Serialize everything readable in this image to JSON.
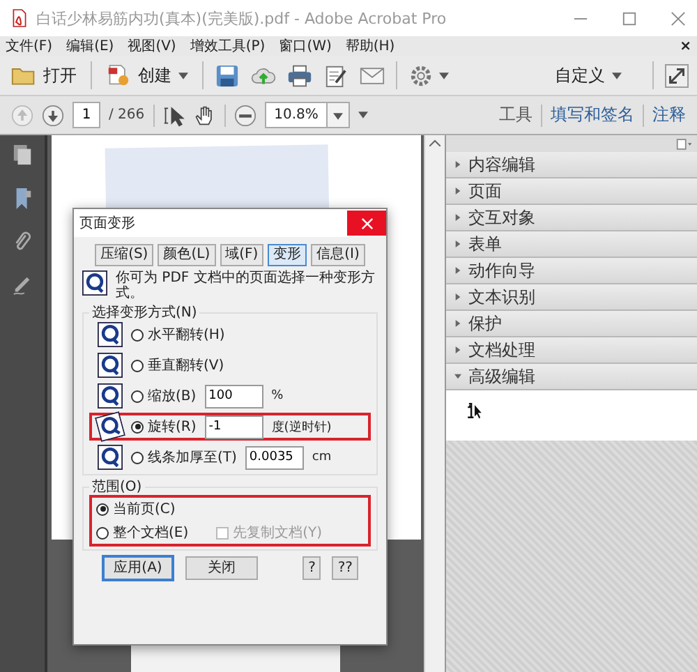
{
  "window": {
    "title": "白话少林易筋内功(真本)(完美版).pdf - Adobe Acrobat Pro"
  },
  "menu": [
    "文件(F)",
    "编辑(E)",
    "视图(V)",
    "增效工具(P)",
    "窗口(W)",
    "帮助(H)"
  ],
  "menu_close": "×",
  "toolbar": {
    "open": "打开",
    "create": "创建",
    "customize": "自定义"
  },
  "nav": {
    "page": "1",
    "page_count": "/ 266",
    "zoom": "10.8%"
  },
  "panel_tabs": [
    {
      "label": "工具",
      "color": "#555555"
    },
    {
      "label": "填写和签名",
      "color": "#2d5f9a"
    },
    {
      "label": "注释",
      "color": "#2d5f9a"
    }
  ],
  "panel_items": [
    {
      "label": "内容编辑",
      "expanded": false
    },
    {
      "label": "页面",
      "expanded": false
    },
    {
      "label": "交互对象",
      "expanded": false
    },
    {
      "label": "表单",
      "expanded": false
    },
    {
      "label": "动作向导",
      "expanded": false
    },
    {
      "label": "文本识别",
      "expanded": false
    },
    {
      "label": "保护",
      "expanded": false
    },
    {
      "label": "文档处理",
      "expanded": false
    },
    {
      "label": "高级编辑",
      "expanded": true
    }
  ],
  "dialog": {
    "title": "页面变形",
    "tabs": [
      {
        "label": "压缩(S)",
        "selected": false
      },
      {
        "label": "颜色(L)",
        "selected": false
      },
      {
        "label": "域(F)",
        "selected": false
      },
      {
        "label": "变形",
        "selected": true
      },
      {
        "label": "信息(I)",
        "selected": false
      }
    ],
    "description": "你可为 PDF 文档中的页面选择一种变形方式。",
    "method_group": "选择变形方式(N)",
    "options": [
      {
        "label": "水平翻转(H)",
        "selected": false,
        "highlighted": false
      },
      {
        "label": "垂直翻转(V)",
        "selected": false,
        "highlighted": false
      },
      {
        "label": "缩放(B)",
        "selected": false,
        "highlighted": false,
        "value": "100",
        "unit": "%"
      },
      {
        "label": "旋转(R)",
        "selected": true,
        "highlighted": true,
        "value": "-1",
        "unit": "度(逆时针)"
      },
      {
        "label": "线条加厚至(T)",
        "selected": false,
        "highlighted": false,
        "value": "0.0035",
        "unit": "cm"
      }
    ],
    "range": {
      "label": "范围(O)",
      "highlighted": true,
      "options": [
        {
          "label": "当前页(C)",
          "selected": true
        },
        {
          "label": "整个文档(E)",
          "selected": false
        }
      ],
      "copy_first": {
        "label": "先复制文档(Y)",
        "checked": false,
        "disabled": true
      }
    },
    "buttons": [
      {
        "label": "应用(A)",
        "default": true,
        "kind": "action"
      },
      {
        "label": "关闭",
        "default": false,
        "kind": "action"
      },
      {
        "label": "?",
        "default": false,
        "kind": "help"
      },
      {
        "label": "??",
        "default": false,
        "kind": "help"
      }
    ]
  }
}
